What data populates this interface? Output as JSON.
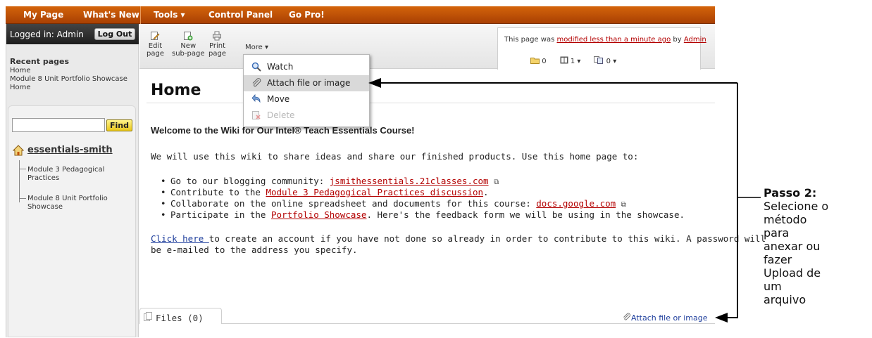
{
  "nav": {
    "items": [
      "My Page",
      "What's New",
      "Tools ▾",
      "Control Panel",
      "Go Pro!"
    ]
  },
  "sidebar": {
    "login_text": "Logged in: Admin",
    "logout_label": "Log Out",
    "recent_title": "Recent pages",
    "recent_pages": [
      "Home",
      "Module 8 Unit Portfolio Showcase",
      "Home"
    ],
    "search_value": "",
    "find_label": "Find",
    "wiki_name": "essentials-smith",
    "tree": [
      "Module 3 Pedagogical Practices",
      "Module 8 Unit Portfolio Showcase"
    ]
  },
  "toolbar": {
    "edit_page": [
      "Edit",
      "page"
    ],
    "new_subpage": [
      "New",
      "sub-page"
    ],
    "print_page": [
      "Print",
      "page"
    ],
    "more": "More ▾"
  },
  "info": {
    "prefix": "This page was ",
    "modified_link": "modified less than a minute ago",
    "by": " by ",
    "user": "Admin",
    "folders": "0",
    "pages": "1 ▾",
    "links": "0 ▾"
  },
  "menu": {
    "items": [
      {
        "label": "Watch",
        "icon": "watch-magnifier-icon",
        "state": "normal"
      },
      {
        "label": "Attach file or image",
        "icon": "paperclip-icon",
        "state": "hover"
      },
      {
        "label": "Move",
        "icon": "move-arrow-icon",
        "state": "normal"
      },
      {
        "label": "Delete",
        "icon": "delete-page-icon",
        "state": "disabled"
      }
    ]
  },
  "page": {
    "title": "Home",
    "welcome": "Welcome to the Wiki for Our Intel® Teach Essentials Course!",
    "intro": "We will use this wiki to share ideas and share our finished products. Use this home page to:",
    "bullets": [
      {
        "pre": "Go to our blogging community: ",
        "link": "jsmithessentials.21classes.com",
        "post": "",
        "external": true
      },
      {
        "pre": "Contribute to the ",
        "link": "Module 3 Pedagogical Practices discussion",
        "post": ".",
        "external": false
      },
      {
        "pre": "Collaborate on the online spreadsheet and documents for this course: ",
        "link": "docs.google.com",
        "post": "",
        "external": true
      },
      {
        "pre": "Participate in the ",
        "link": "Portfolio Showcase",
        "post": ". Here's the feedback form we will be using in the showcase.",
        "external": false
      }
    ],
    "click_here": "Click here ",
    "click_rest1": "to create an account if you have not done so already in order to contribute to this wiki. A password will",
    "click_rest2": "be e-mailed to the address you specify."
  },
  "files": {
    "tab_label": "Files (0)",
    "attach_label": "Attach file or image"
  },
  "annotation": {
    "title": "Passo 2:",
    "lines": [
      "Selecione o",
      "método",
      "para",
      "anexar ou",
      "fazer",
      "Upload de",
      "um",
      "arquivo"
    ]
  },
  "colors": {
    "nav_bar": "#c0530a",
    "link_red": "#b30000",
    "link_blue": "#1d3d9c"
  }
}
